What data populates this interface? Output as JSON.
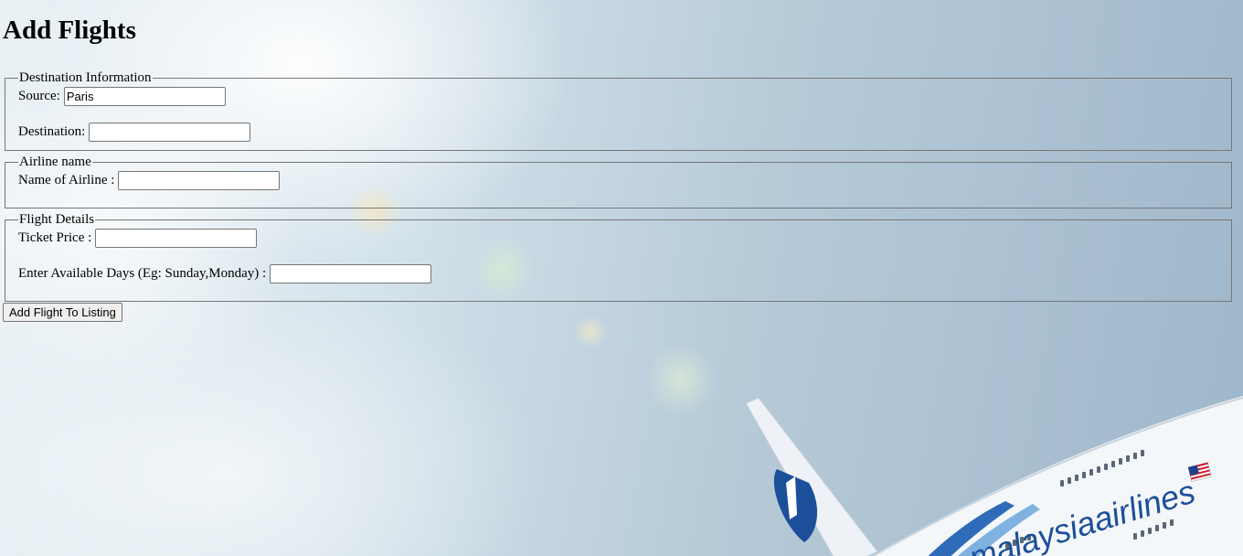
{
  "page": {
    "title": "Add Flights"
  },
  "destination": {
    "legend": "Destination Information",
    "source_label": "Source:",
    "source_value": "Paris",
    "destination_label": "Destination:",
    "destination_value": ""
  },
  "airline": {
    "legend": "Airline name",
    "name_label": "Name of Airline :",
    "name_value": ""
  },
  "flight": {
    "legend": "Flight Details",
    "price_label": "Ticket Price :",
    "price_value": "",
    "days_label": "Enter Available Days (Eg: Sunday,Monday) :",
    "days_value": ""
  },
  "submit": {
    "label": "Add Flight To Listing"
  },
  "background": {
    "livery_text": "malaysiaairlines"
  }
}
